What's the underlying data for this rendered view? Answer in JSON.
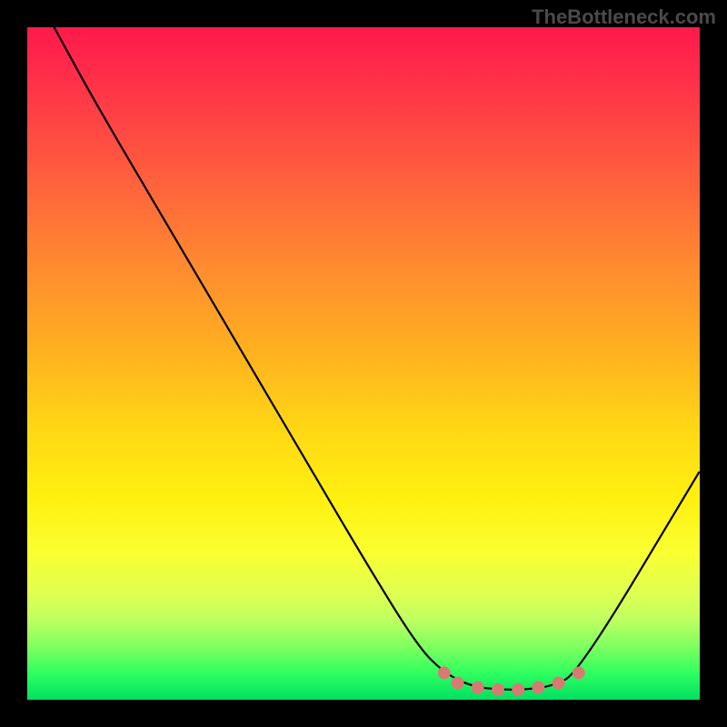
{
  "watermark": "TheBottleneck.com",
  "chart_data": {
    "type": "line",
    "title": "",
    "xlabel": "",
    "ylabel": "",
    "xlim": [
      0,
      100
    ],
    "ylim": [
      0,
      100
    ],
    "series": [
      {
        "name": "bottleneck-curve",
        "x": [
          4,
          10,
          20,
          30,
          40,
          50,
          58,
          62,
          66,
          70,
          74,
          78,
          82,
          100
        ],
        "y": [
          100,
          89,
          72,
          55,
          38,
          21,
          8,
          4,
          2,
          1.5,
          1.5,
          2,
          4,
          34
        ]
      }
    ],
    "markers": {
      "name": "highlight-dots",
      "color": "#d87a74",
      "points": [
        {
          "x": 62,
          "y": 4
        },
        {
          "x": 64,
          "y": 2.5
        },
        {
          "x": 67,
          "y": 1.8
        },
        {
          "x": 70,
          "y": 1.5
        },
        {
          "x": 73,
          "y": 1.5
        },
        {
          "x": 76,
          "y": 1.8
        },
        {
          "x": 79,
          "y": 2.5
        },
        {
          "x": 82,
          "y": 4
        }
      ]
    },
    "background": "heatmap-gradient-red-to-green"
  }
}
